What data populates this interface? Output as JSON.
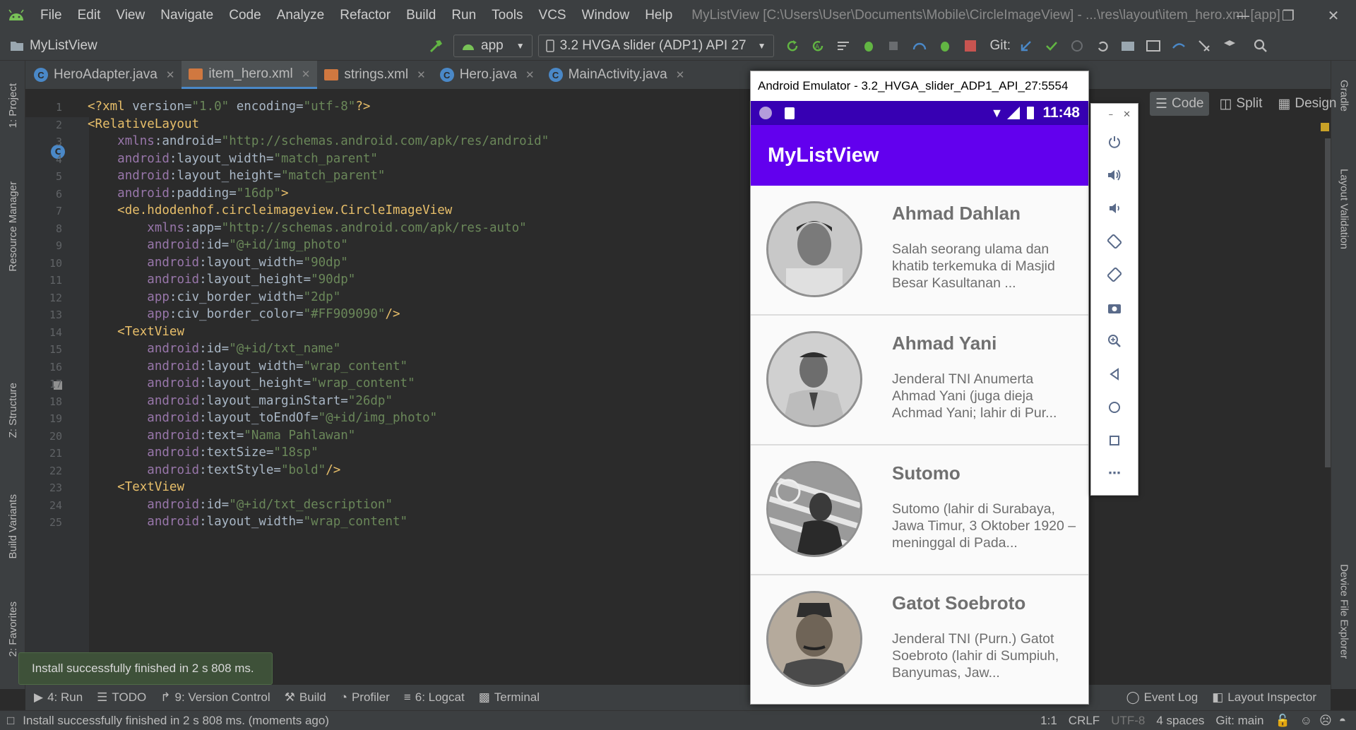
{
  "menu": {
    "items": [
      "File",
      "Edit",
      "View",
      "Navigate",
      "Code",
      "Analyze",
      "Refactor",
      "Build",
      "Run",
      "Tools",
      "VCS",
      "Window",
      "Help"
    ],
    "window_title": "MyListView [C:\\Users\\User\\Documents\\Mobile\\CircleImageView] - ...\\res\\layout\\item_hero.xml [app]"
  },
  "toolbar": {
    "project": "MyListView",
    "config": "app",
    "device": "3.2  HVGA slider (ADP1) API 27",
    "git_label": "Git:"
  },
  "tabs": [
    {
      "label": "HeroAdapter.java"
    },
    {
      "label": "item_hero.xml"
    },
    {
      "label": "strings.xml"
    },
    {
      "label": "Hero.java"
    },
    {
      "label": "MainActivity.java"
    }
  ],
  "view_modes": {
    "code": "Code",
    "split": "Split",
    "design": "Design"
  },
  "left_tools": {
    "project": "1: Project",
    "resource": "Resource Manager",
    "structure": "Z: Structure",
    "build_variants": "Build Variants",
    "favorites": "2: Favorites"
  },
  "right_tools": {
    "gradle": "Gradle",
    "layout_validation": "Layout Validation",
    "device_file": "Device File Explorer"
  },
  "editor": {
    "line_numbers": [
      "1",
      "2",
      "3",
      "4",
      "5",
      "6",
      "7",
      "8",
      "9",
      "10",
      "11",
      "12",
      "13",
      "14",
      "15",
      "16",
      "17",
      "18",
      "19",
      "20",
      "21",
      "22",
      "23",
      "24",
      "25"
    ],
    "lines": [
      [
        "<?xml version=\"1.0\" encoding=\"utf-8\"?>"
      ],
      [
        "<RelativeLayout"
      ],
      [
        "    xmlns:android=\"http://schemas.android.com/apk/res/android\""
      ],
      [
        "    android:layout_width=\"match_parent\""
      ],
      [
        "    android:layout_height=\"match_parent\""
      ],
      [
        "    android:padding=\"16dp\">"
      ],
      [
        "    <de.hdodenhof.circleimageview.CircleImageView"
      ],
      [
        "        xmlns:app=\"http://schemas.android.com/apk/res-auto\""
      ],
      [
        "        android:id=\"@+id/img_photo\""
      ],
      [
        "        android:layout_width=\"90dp\""
      ],
      [
        "        android:layout_height=\"90dp\""
      ],
      [
        "        app:civ_border_width=\"2dp\""
      ],
      [
        "        app:civ_border_color=\"#FF909090\"/>"
      ],
      [
        "    <TextView"
      ],
      [
        "        android:id=\"@+id/txt_name\""
      ],
      [
        "        android:layout_width=\"wrap_content\""
      ],
      [
        "        android:layout_height=\"wrap_content\""
      ],
      [
        "        android:layout_marginStart=\"26dp\""
      ],
      [
        "        android:layout_toEndOf=\"@+id/img_photo\""
      ],
      [
        "        android:text=\"Nama Pahlawan\""
      ],
      [
        "        android:textSize=\"18sp\""
      ],
      [
        "        android:textStyle=\"bold\"/>"
      ],
      [
        "    <TextView"
      ],
      [
        "        android:id=\"@+id/txt_description\""
      ],
      [
        "        android:layout_width=\"wrap_content\""
      ]
    ]
  },
  "bottom_tools": [
    "4: Run",
    "TODO",
    "9: Version Control",
    "Build",
    "Profiler",
    "6: Logcat",
    "Terminal"
  ],
  "bottom_right_tools": [
    "Event Log",
    "Layout Inspector"
  ],
  "balloon": "Install successfully finished in 2 s 808 ms.",
  "status": {
    "message": "Install successfully finished in 2 s 808 ms. (moments ago)",
    "position": "1:1",
    "line_sep": "CRLF",
    "encoding": "UTF-8",
    "indent": "4 spaces",
    "git": "Git: main"
  },
  "emulator": {
    "title": "Android Emulator - 3.2_HVGA_slider_ADP1_API_27:5554",
    "time": "11:48",
    "app_title": "MyListView",
    "heroes": [
      {
        "name": "Ahmad Dahlan",
        "desc": "Salah seorang ulama dan khatib terkemuka di Masjid Besar Kasultanan ..."
      },
      {
        "name": "Ahmad Yani",
        "desc": "Jenderal TNI Anumerta Ahmad Yani (juga dieja Achmad Yani; lahir di Pur..."
      },
      {
        "name": "Sutomo",
        "desc": "Sutomo (lahir di Surabaya, Jawa Timur, 3 Oktober 1920 – meninggal di Pada..."
      },
      {
        "name": "Gatot Soebroto",
        "desc": "Jenderal TNI (Purn.) Gatot Soebroto (lahir di Sumpiuh, Banyumas, Jaw..."
      }
    ]
  },
  "colors": {
    "app_bar": "#6200ee",
    "status_bar": "#3700b3",
    "ide_bg": "#2b2b2b",
    "balloon": "#3e5139"
  }
}
